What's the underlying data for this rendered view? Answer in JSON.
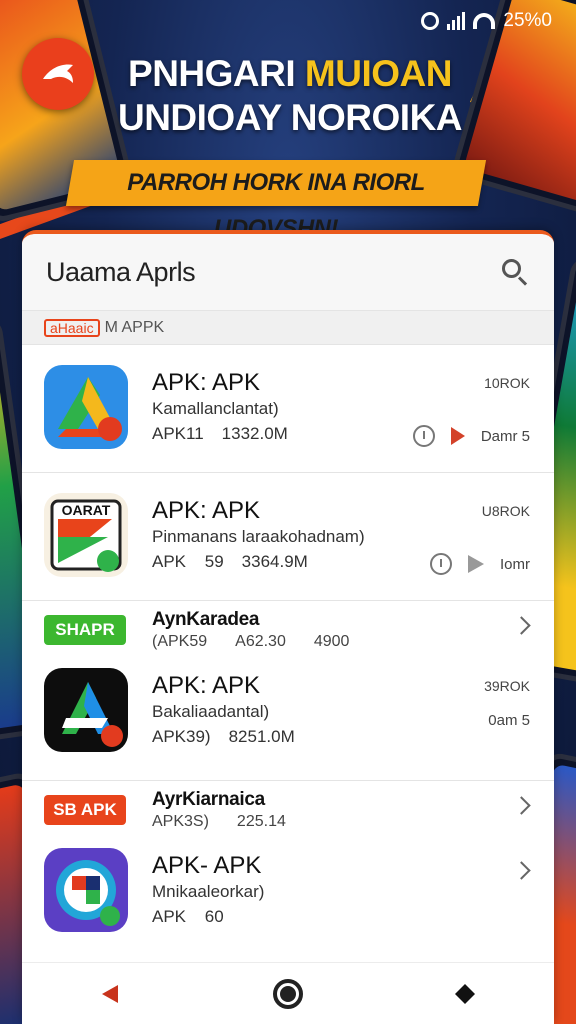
{
  "status_bar": {
    "battery_text": "25%0"
  },
  "header": {
    "headline_line1_a": "PNHGARI",
    "headline_line1_b": "MUIOAN",
    "headline_line2": "UNDIOAY NOROIKA",
    "banner": "PARROH HORK INA RIORL UDOVSHN!"
  },
  "card": {
    "title": "Uaama Aprls",
    "section_label_badge": "aHaaic",
    "section_label_text": "M APPK"
  },
  "apps": [
    {
      "title": "APK: APK",
      "subtitle": "Kamallanclantat)",
      "meta_a": "APK11",
      "meta_b": "1332.0M",
      "right_top": "10ROK",
      "right_action": "Damr 5"
    },
    {
      "title": "APK: APK",
      "subtitle": "Pinmanans laraakohadnam)",
      "meta_a": "APK 59",
      "meta_b": "3364.9M",
      "right_top": "U8ROK",
      "right_action": "Iomr"
    }
  ],
  "categories": [
    {
      "badge": "SHAPR",
      "badge_color": "#3cb72f",
      "title": "AynKaradea",
      "meta_a": "(APK59",
      "meta_b": "A62.30",
      "meta_c": "4900"
    },
    {
      "badge": "SB APK",
      "badge_color": "#e8441b",
      "title": "AyrKiarnaica",
      "meta_a": "APK3S)",
      "meta_b": "225.14"
    }
  ],
  "apps_2": [
    {
      "title": "APK: APK",
      "subtitle": "Bakaliaadantal)",
      "meta_a": "APK39)",
      "meta_b": "8251.0M",
      "right_top": "39ROK",
      "right_action": "0am 5"
    },
    {
      "title": "APK- APK",
      "subtitle": "Mnikaaleorkar)",
      "meta_a": "APK 60"
    }
  ],
  "colors": {
    "accent": "#ea5a1d",
    "banner": "#f5a417",
    "headline_accent": "#f6c21c",
    "background": "#142552"
  },
  "icons": {
    "logo": "logo-icon",
    "search": "search-icon",
    "nav_back": "back-icon",
    "nav_home": "home-icon",
    "nav_recent": "recent-icon"
  }
}
